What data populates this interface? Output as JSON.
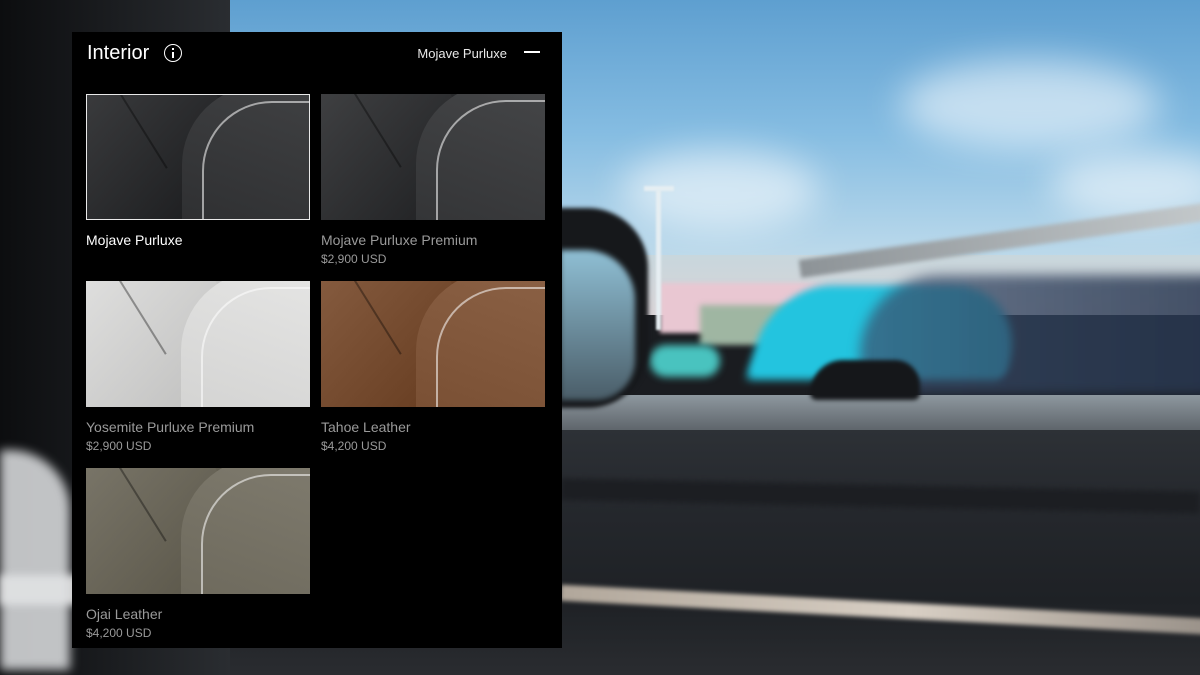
{
  "panel": {
    "title": "Interior",
    "selected_name": "Mojave Purluxe"
  },
  "options": [
    {
      "name": "Mojave Purluxe",
      "price": "",
      "selected": true,
      "color": "#2f3032"
    },
    {
      "name": "Mojave Purluxe Premium",
      "price": "$2,900 USD",
      "selected": false,
      "color": "#343537"
    },
    {
      "name": "Yosemite Purluxe Premium",
      "price": "$2,900 USD",
      "selected": false,
      "color": "#d4d4d3"
    },
    {
      "name": "Tahoe Leather",
      "price": "$4,200 USD",
      "selected": false,
      "color": "#7a5034"
    },
    {
      "name": "Ojai Leather",
      "price": "$4,200 USD",
      "selected": false,
      "color": "#6e6a5d"
    }
  ],
  "icons": {
    "info": "info-icon",
    "collapse": "minus-icon"
  }
}
